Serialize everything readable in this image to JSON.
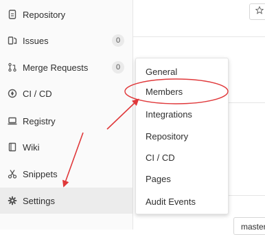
{
  "sidebar": {
    "items": [
      {
        "label": "Repository",
        "icon": "document-icon"
      },
      {
        "label": "Issues",
        "icon": "issues-icon",
        "badge": "0"
      },
      {
        "label": "Merge Requests",
        "icon": "merge-request-icon",
        "badge": "0"
      },
      {
        "label": "CI / CD",
        "icon": "rocket-icon"
      },
      {
        "label": "Registry",
        "icon": "laptop-icon"
      },
      {
        "label": "Wiki",
        "icon": "book-icon"
      },
      {
        "label": "Snippets",
        "icon": "scissors-icon"
      },
      {
        "label": "Settings",
        "icon": "gear-icon"
      }
    ]
  },
  "flyout": {
    "items": [
      {
        "label": "General"
      },
      {
        "label": "Members"
      },
      {
        "label": "Integrations"
      },
      {
        "label": "Repository"
      },
      {
        "label": "CI / CD"
      },
      {
        "label": "Pages"
      },
      {
        "label": "Audit Events"
      }
    ]
  },
  "main": {
    "star_icon": "star-icon",
    "branch_value": "master"
  },
  "colors": {
    "annotation": "#e0383a",
    "active_item_bg": "#ececec",
    "sidebar_bg": "#fafafa"
  }
}
